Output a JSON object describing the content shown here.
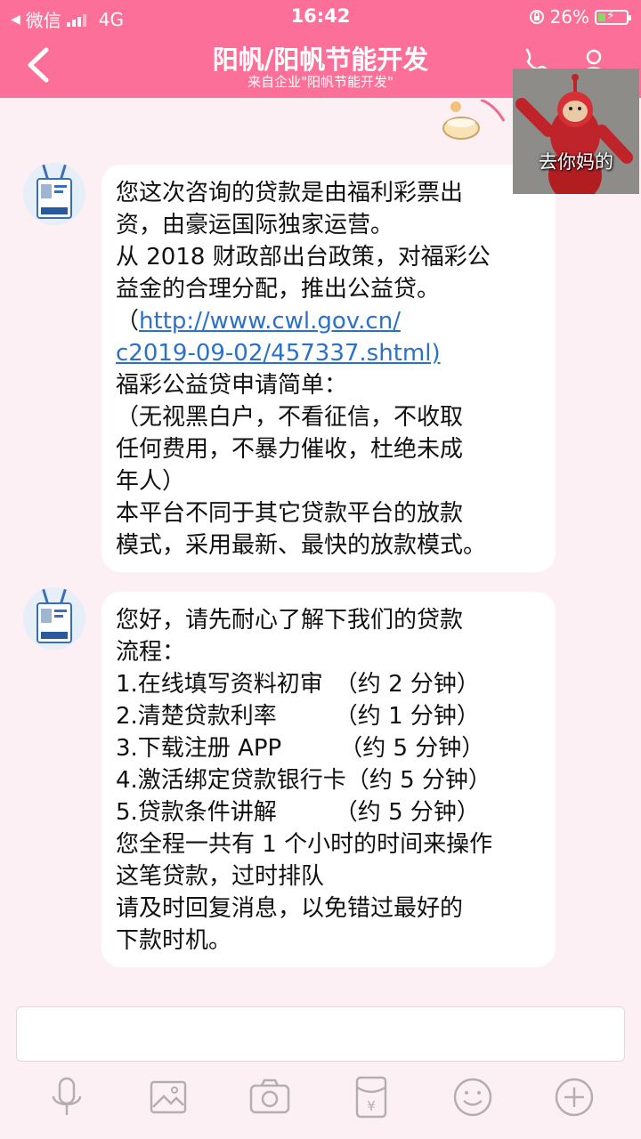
{
  "status": {
    "carrier": "微信",
    "network": "4G",
    "time": "16:42",
    "battery": "26%",
    "battery_level": 0.26
  },
  "nav": {
    "title": "阳帆/阳帆节能开发",
    "subtitle": "来自企业\"阳帆节能开发\""
  },
  "sticker": {
    "caption": "去你妈的"
  },
  "messages": [
    {
      "lines": [
        "您这次咨询的贷款是由福利彩票出",
        "资，由豪运国际独家运营。",
        "从 2018 财政部出台政策，对福彩公",
        "益金的合理分配，推出公益贷。",
        "（",
        "http://www.cwl.gov.cn/",
        "c2019-09-02/457337.shtml)",
        "福彩公益贷申请简单：",
        "（无视黑白户，不看征信，不收取",
        "任何费用，不暴力催收，杜绝未成",
        "年人）",
        "本平台不同于其它贷款平台的放款",
        "模式，采用最新、最快的放款模式。"
      ]
    },
    {
      "lines": [
        "您好，请先耐心了解下我们的贷款",
        "流程：",
        "1.在线填写资料初审　（约 2 分钟）",
        "2.清楚贷款利率　　　（约 1 分钟）",
        "3.下载注册 APP　　　（约 5 分钟）",
        "4.激活绑定贷款银行卡（约 5 分钟）",
        "5.贷款条件讲解　　　（约 5 分钟）",
        "您全程一共有 1 个小时的时间来操作",
        "这笔贷款，过时排队",
        "请及时回复消息，以免错过最好的",
        "下款时机。"
      ]
    }
  ],
  "input": {
    "placeholder": ""
  },
  "colors": {
    "accent": "#fc6f98",
    "background": "#fdf0f4",
    "bubble": "#ffffff",
    "link": "#2b71c7",
    "icon": "#b5aeb0"
  },
  "toolbar_icons": [
    "microphone-icon",
    "image-icon",
    "camera-icon",
    "red-packet-icon",
    "emoji-icon",
    "plus-icon"
  ]
}
